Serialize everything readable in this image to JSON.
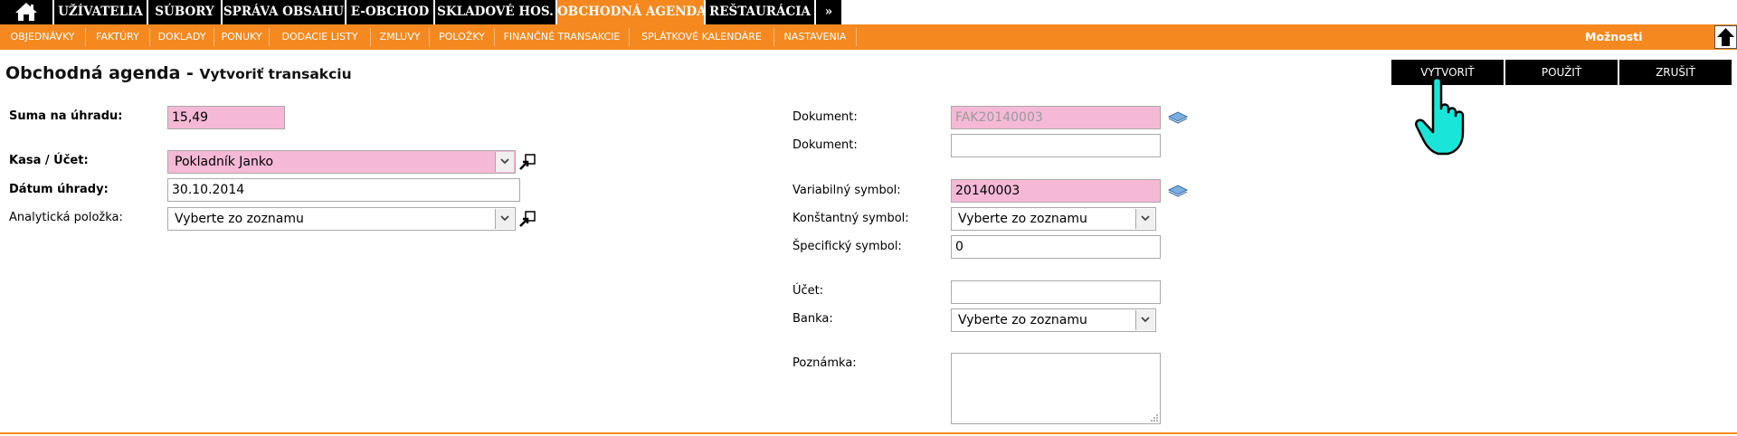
{
  "topnav": {
    "items": [
      "UŽÍVATELIA",
      "SÚBORY",
      "SPRÁVA OBSAHU",
      "E-OBCHOD",
      "SKLADOVÉ HOS.",
      "OBCHODNÁ AGENDA",
      "REŠTAURÁCIA",
      "»"
    ],
    "active": "OBCHODNÁ AGENDA"
  },
  "subnav": {
    "items": [
      "OBJEDNÁVKY",
      "FAKTÚRY",
      "DOKLADY",
      "PONUKY",
      "DODACIE LISTY",
      "ZMLUVY",
      "POLOŽKY",
      "FINANČNÉ TRANSAKCIE",
      "SPLÁTKOVÉ KALENDÁRE",
      "NASTAVENIA"
    ],
    "options_label": "Možnosti"
  },
  "page": {
    "title": "Obchodná agenda - ",
    "subtitle": "Vytvoriť transakciu"
  },
  "actions": {
    "create": "VYTVORIŤ",
    "apply": "POUŽIŤ",
    "cancel": "ZRUŠIŤ"
  },
  "form_left": {
    "amount_label": "Suma na úhradu:",
    "amount_value": "15,49",
    "cash_label": "Kasa / Účet:",
    "cash_value": "Pokladník Janko",
    "date_label": "Dátum úhrady:",
    "date_value": "30.10.2014",
    "analytic_label": "Analytická položka:",
    "analytic_value": "Vyberte zo zoznamu"
  },
  "form_right": {
    "doc1_label": "Dokument:",
    "doc1_value": "FAK20140003",
    "doc2_label": "Dokument:",
    "doc2_value": "",
    "vs_label": "Variabilný symbol:",
    "vs_value": "20140003",
    "ks_label": "Konštantný symbol:",
    "ks_value": "Vyberte zo zoznamu",
    "ss_label": "Špecifický symbol:",
    "ss_value": "0",
    "account_label": "Účet:",
    "account_value": "",
    "bank_label": "Banka:",
    "bank_value": "Vyberte zo zoznamu",
    "note_label": "Poznámka:",
    "note_value": ""
  },
  "colors": {
    "accent": "#f5891f",
    "nav_bg": "#000000",
    "required_bg": "#f5b9d6",
    "cursor": "#19e6d9"
  }
}
